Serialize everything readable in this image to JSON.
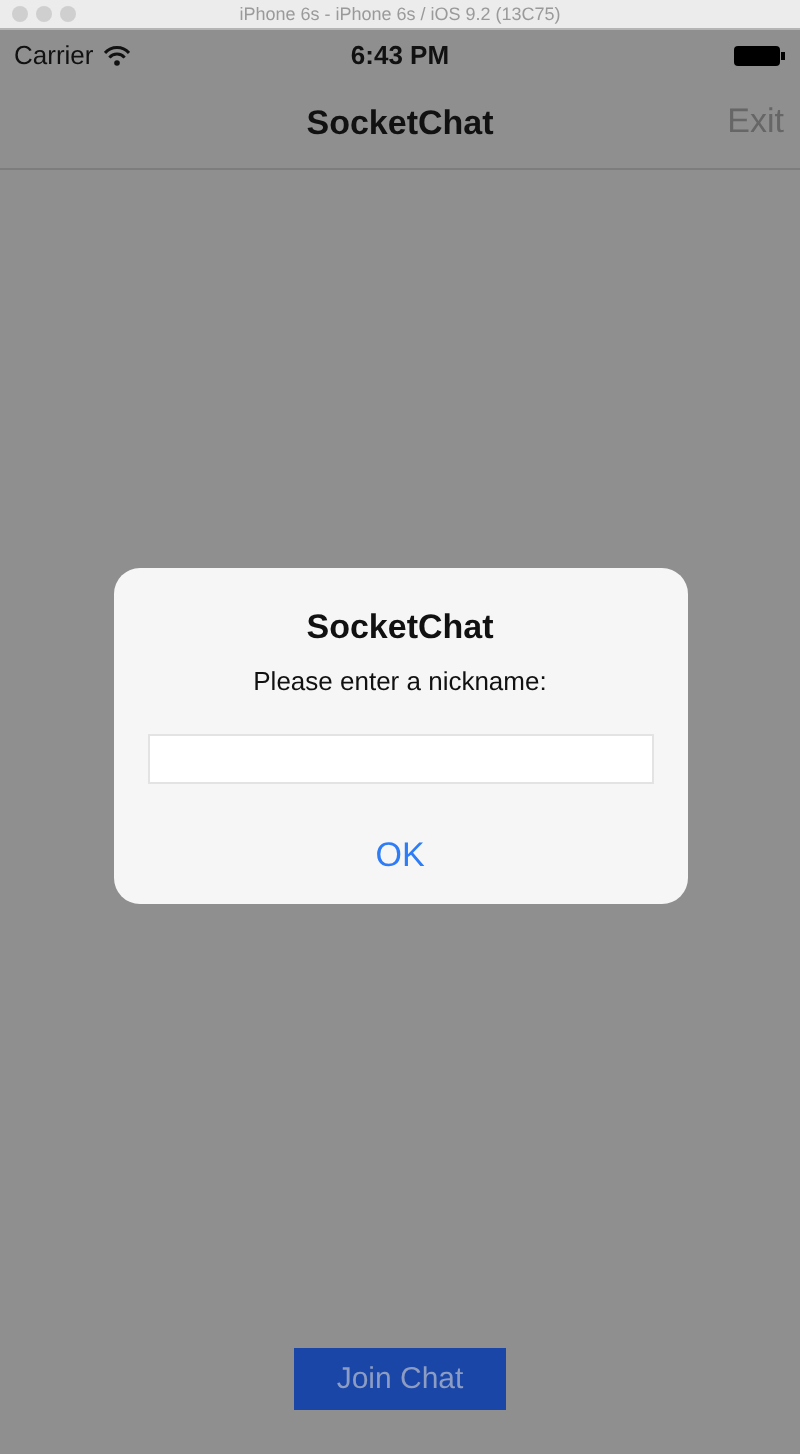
{
  "window": {
    "title": "iPhone 6s - iPhone 6s / iOS 9.2 (13C75)"
  },
  "status_bar": {
    "carrier": "Carrier",
    "time": "6:43 PM"
  },
  "nav_bar": {
    "title": "SocketChat",
    "right_button": "Exit"
  },
  "alert": {
    "title": "SocketChat",
    "message": "Please enter a nickname:",
    "button": "OK"
  },
  "join_button": "Join Chat"
}
